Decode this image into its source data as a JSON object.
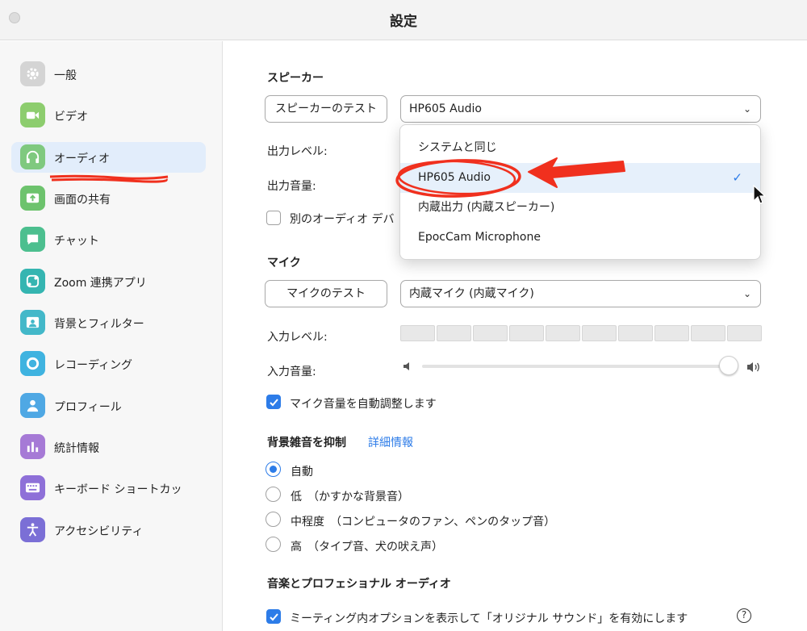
{
  "window": {
    "title": "設定"
  },
  "sidebar": {
    "items": [
      {
        "label": "一般",
        "icon": "gear-icon",
        "color": "#d4d4d4"
      },
      {
        "label": "ビデオ",
        "icon": "video-camera-icon",
        "color": "#8dcd6e"
      },
      {
        "label": "オーディオ",
        "icon": "headphones-icon",
        "color": "#7fc97f"
      },
      {
        "label": "画面の共有",
        "icon": "share-screen-icon",
        "color": "#6dc36d"
      },
      {
        "label": "チャット",
        "icon": "chat-bubble-icon",
        "color": "#4cbf8f"
      },
      {
        "label": "Zoom 連携アプリ",
        "icon": "apps-icon",
        "color": "#35b5b1"
      },
      {
        "label": "背景とフィルター",
        "icon": "background-person-icon",
        "color": "#43b8c9"
      },
      {
        "label": "レコーディング",
        "icon": "record-icon",
        "color": "#3fb3e0"
      },
      {
        "label": "プロフィール",
        "icon": "profile-person-icon",
        "color": "#4fa8e4"
      },
      {
        "label": "統計情報",
        "icon": "bar-chart-icon",
        "color": "#a67ad6"
      },
      {
        "label": "キーボード ショートカッ",
        "icon": "keyboard-icon",
        "color": "#8e70d8"
      },
      {
        "label": "アクセシビリティ",
        "icon": "accessibility-icon",
        "color": "#7b6fd6"
      }
    ],
    "active_index": 2,
    "accent_color": "#e2edfb"
  },
  "speaker": {
    "section_title": "スピーカー",
    "test_button": "スピーカーのテスト",
    "selected_device": "HP605 Audio",
    "output_level_label": "出力レベル:",
    "output_volume_label": "出力音量:",
    "separate_audio_label": "別のオーディオ デバ",
    "separate_audio_checked": false
  },
  "speaker_dropdown": {
    "options": [
      {
        "label": "システムと同じ",
        "selected": false
      },
      {
        "label": "HP605 Audio",
        "selected": true
      },
      {
        "label": "内蔵出力 (内蔵スピーカー)",
        "selected": false
      },
      {
        "label": "EpocCam Microphone",
        "selected": false
      }
    ],
    "check_glyph": "✓"
  },
  "mic": {
    "section_title": "マイク",
    "test_button": "マイクのテスト",
    "selected_device": "内蔵マイク (内蔵マイク)",
    "input_level_label": "入力レベル:",
    "input_volume_label": "入力音量:",
    "input_volume_value": 0.96,
    "auto_adjust_label": "マイク音量を自動調整します",
    "auto_adjust_checked": true
  },
  "noise": {
    "section_title": "背景雑音を抑制",
    "more_info_link": "詳細情報",
    "options": [
      {
        "label": "自動",
        "selected": true
      },
      {
        "label": "低　（かすかな背景音）",
        "selected": false
      },
      {
        "label": "中程度　（コンピュータのファン、ペンのタップ音）",
        "selected": false
      },
      {
        "label": "高　（タイプ音、犬の吠え声）",
        "selected": false
      }
    ]
  },
  "music": {
    "section_title": "音楽とプロフェショナル オーディオ",
    "original_sound_label": "ミーティング内オプションを表示して「オリジナル サウンド」を有効にします",
    "original_sound_checked": true,
    "help_glyph": "?"
  },
  "colors": {
    "accent_blue": "#2d7ce8",
    "annotation_red": "#f0301e"
  }
}
